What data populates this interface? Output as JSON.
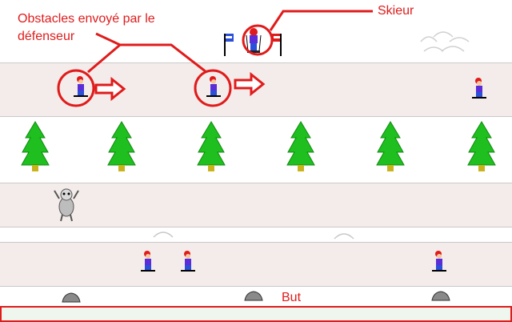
{
  "annotations": {
    "obstacles_label_line1": "Obstacles envoyé par le",
    "obstacles_label_line2": "défenseur",
    "skier_label": "Skieur",
    "goal_label": "But"
  },
  "colors": {
    "annotation_red": "#e01b1b",
    "lane_pink": "#f4ecea",
    "goal_fill": "#eef6ee",
    "tree_green": "#1fbf1f"
  },
  "icons": [
    "skier-icon",
    "arrow-right-icon",
    "pine-tree-icon",
    "yeti-icon",
    "rock-icon",
    "snow-bump-icon",
    "start-gate-flag-icon"
  ]
}
